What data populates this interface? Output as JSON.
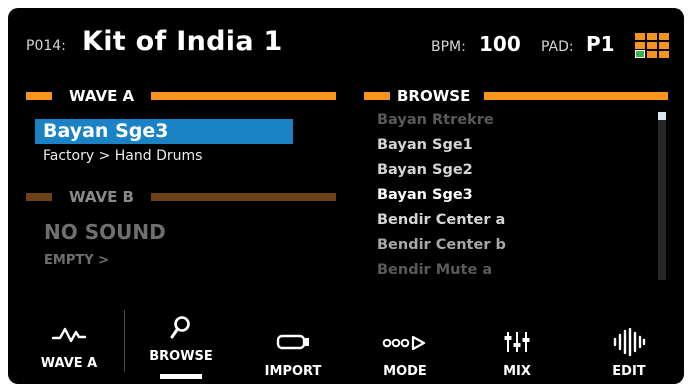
{
  "header": {
    "preset_number": "P014:",
    "preset_name": "Kit of India 1",
    "bpm_label": "BPM:",
    "bpm_value": "100",
    "pad_label": "PAD:",
    "pad_value": "P1"
  },
  "wave_a": {
    "title": "WAVE A",
    "selected_sample": "Bayan Sge3",
    "path": "Factory >  Hand Drums"
  },
  "wave_b": {
    "title": "WAVE B",
    "status": "NO SOUND",
    "path": "EMPTY >"
  },
  "browse": {
    "title": "BROWSE",
    "items": [
      {
        "label": "Bayan Rtrekre",
        "color": "#5a5a5a"
      },
      {
        "label": "Bayan Sge1",
        "color": "#d4d4d4"
      },
      {
        "label": "Bayan Sge2",
        "color": "#d4d4d4"
      },
      {
        "label": "Bayan Sge3",
        "color": "#ffffff"
      },
      {
        "label": "Bendir Center a",
        "color": "#d4d4d4"
      },
      {
        "label": "Bendir Center b",
        "color": "#a8a8a8"
      },
      {
        "label": "Bendir Mute a",
        "color": "#5a5a5a"
      }
    ]
  },
  "nav": {
    "wave_a": "WAVE A",
    "browse": "BROWSE",
    "import": "IMPORT",
    "mode": "MODE",
    "mix": "MIX",
    "edit": "EDIT"
  },
  "colors": {
    "accent_orange": "#f7941d",
    "dim_orange": "#6b4118",
    "selection_blue": "#1b82c3",
    "pad_green": "#37b34a"
  },
  "icons": [
    "grid-pad-icon",
    "wave-icon",
    "search-icon",
    "import-icon",
    "mode-icon",
    "mix-icon",
    "edit-icon"
  ]
}
